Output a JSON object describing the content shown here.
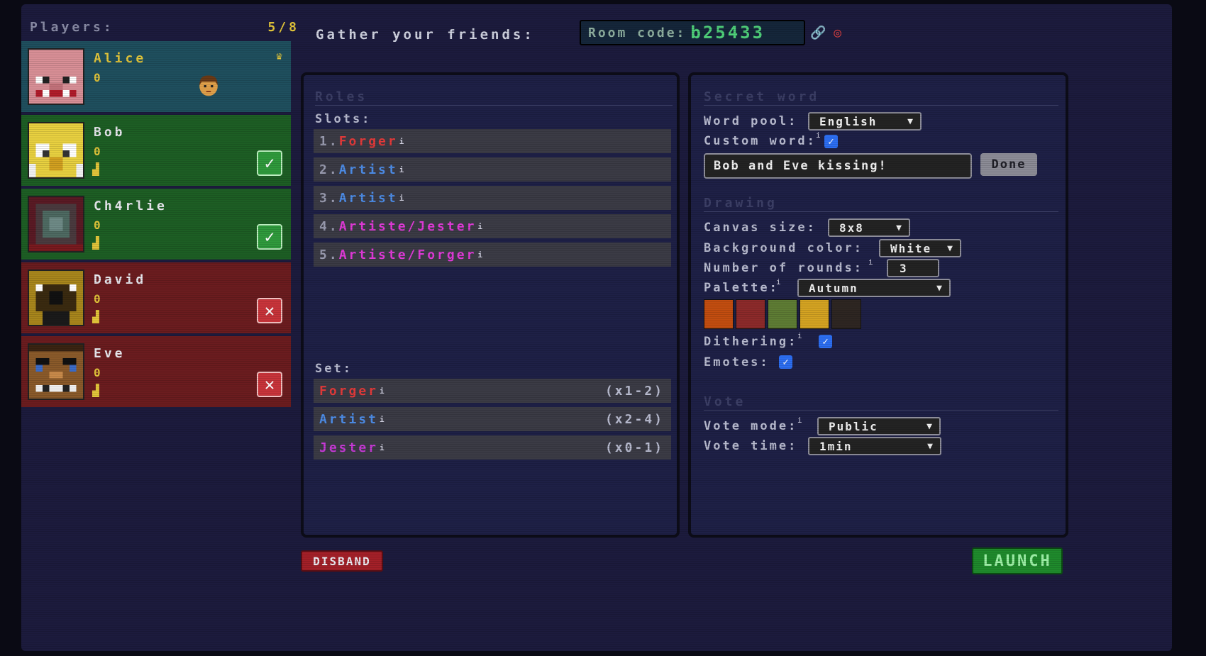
{
  "players": {
    "heading": "Players:",
    "count": "5/8",
    "list": [
      {
        "name": "Alice",
        "score": "0",
        "color": "#1f4f5e",
        "status": "host",
        "host_icon": "crown-icon"
      },
      {
        "name": "Bob",
        "score": "0",
        "color": "#1d5e24",
        "status": "ready"
      },
      {
        "name": "Ch4rlie",
        "score": "0",
        "color": "#1d5e24",
        "status": "ready"
      },
      {
        "name": "David",
        "score": "0",
        "color": "#6b1c1f",
        "status": "not-ready"
      },
      {
        "name": "Eve",
        "score": "0",
        "color": "#6b1c1f",
        "status": "not-ready"
      }
    ]
  },
  "header": {
    "gather_label": "Gather your friends:",
    "room_code_label": "Room code:",
    "room_code": "b25433"
  },
  "roles": {
    "title": "Roles",
    "slots_label": "Slots:",
    "slots": [
      {
        "num": "1.",
        "name": "Forger",
        "color": "#e23a3a"
      },
      {
        "num": "2.",
        "name": "Artist",
        "color": "#4d8de8"
      },
      {
        "num": "3.",
        "name": "Artist",
        "color": "#4d8de8"
      },
      {
        "num": "4.",
        "name": "Artiste/Jester",
        "color": "#e03ad8"
      },
      {
        "num": "5.",
        "name": "Artiste/Forger",
        "color": "#e03ad8"
      }
    ],
    "set_label": "Set:",
    "set": [
      {
        "name": "Forger",
        "range": "(x1-2)",
        "color": "#e23a3a"
      },
      {
        "name": "Artist",
        "range": "(x2-4)",
        "color": "#4d8de8"
      },
      {
        "name": "Jester",
        "range": "(x0-1)",
        "color": "#c83ad8"
      }
    ],
    "info_mark": "i"
  },
  "secret_word": {
    "title": "Secret word",
    "word_pool_label": "Word pool:",
    "word_pool_value": "English",
    "custom_word_label": "Custom word:",
    "custom_word_value": "Bob and Eve kissing!",
    "done_label": "Done"
  },
  "drawing": {
    "title": "Drawing",
    "canvas_size_label": "Canvas size:",
    "canvas_size_value": "8x8",
    "bg_color_label": "Background color:",
    "bg_color_value": "White",
    "rounds_label": "Number of rounds:",
    "rounds_value": "3",
    "palette_label": "Palette:",
    "palette_value": "Autumn",
    "palette_colors": [
      "#c24d10",
      "#8c2a2a",
      "#5e7c34",
      "#d4a322",
      "#2e2622"
    ],
    "dithering_label": "Dithering:",
    "emotes_label": "Emotes:"
  },
  "vote": {
    "title": "Vote",
    "mode_label": "Vote mode:",
    "mode_value": "Public",
    "time_label": "Vote time:",
    "time_value": "1min"
  },
  "buttons": {
    "disband": "DISBAND",
    "launch": "LAUNCH"
  }
}
